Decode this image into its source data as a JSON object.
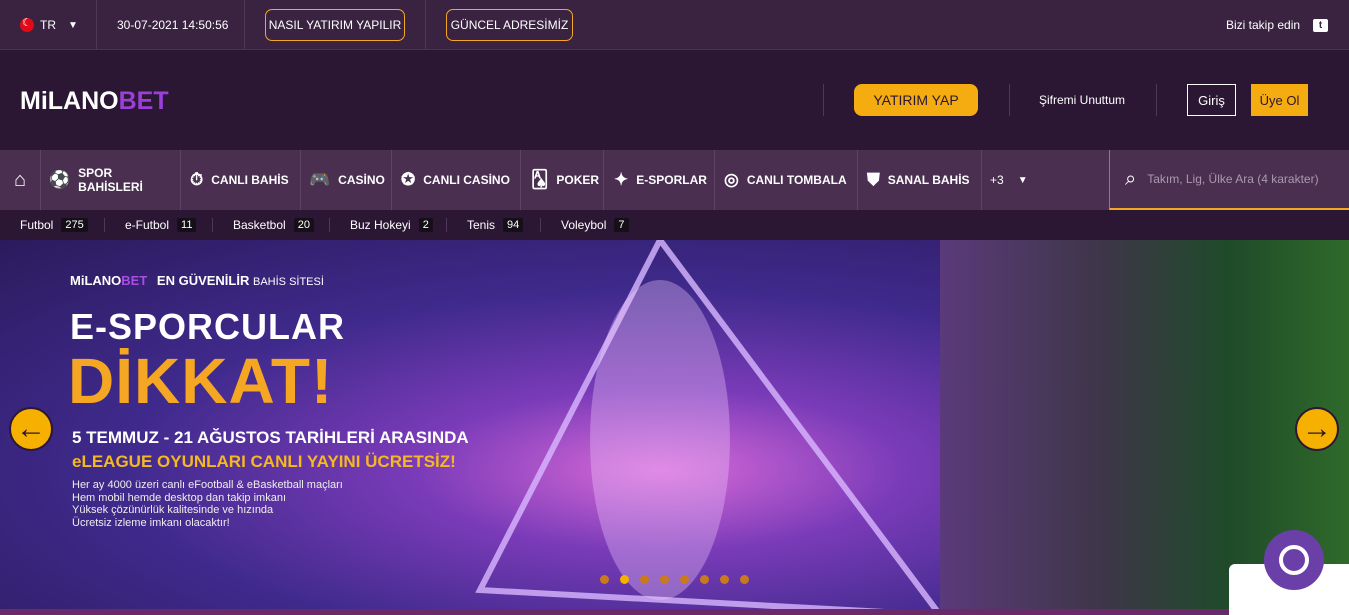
{
  "topbar": {
    "lang": "TR",
    "datetime": "30-07-2021 14:50:56",
    "btn_how": "NASIL YATIRIM YAPILIR",
    "btn_address": "GÜNCEL ADRESİMİZ",
    "follow": "Bizi takip edin"
  },
  "header": {
    "logo_a": "MiLANO",
    "logo_b": "BET",
    "deposit": "YATIRIM YAP",
    "forgot": "Şifremi Unuttum",
    "login": "Giriş",
    "register": "Üye Ol"
  },
  "nav": {
    "items": [
      {
        "label": "SPOR BAHİSLERİ",
        "icon": "soccer-ball-icon"
      },
      {
        "label": "CANLI BAHİS",
        "icon": "stopwatch-icon"
      },
      {
        "label": "CASİNO",
        "icon": "gamepad-icon"
      },
      {
        "label": "CANLI CASİNO",
        "icon": "poker-chip-icon"
      },
      {
        "label": "POKER",
        "icon": "cards-icon"
      },
      {
        "label": "E-SPORLAR",
        "icon": "esports-icon"
      },
      {
        "label": "CANLI TOMBALA",
        "icon": "tombala-icon"
      },
      {
        "label": "SANAL BAHİS",
        "icon": "shield-icon"
      }
    ],
    "more": "+3",
    "search_placeholder": "Takım, Lig, Ülke Ara (4 karakter)"
  },
  "sports": [
    {
      "name": "Futbol",
      "count": "275"
    },
    {
      "name": "e-Futbol",
      "count": "11"
    },
    {
      "name": "Basketbol",
      "count": "20"
    },
    {
      "name": "Buz Hokeyi",
      "count": "2"
    },
    {
      "name": "Tenis",
      "count": "94"
    },
    {
      "name": "Voleybol",
      "count": "7"
    }
  ],
  "banner": {
    "brand_a": "MiLANO",
    "brand_b": "BET",
    "brand_tag": "EN GÜVENİLİR",
    "brand_tag2": "BAHİS SİTESİ",
    "title1": "E-SPORCULAR",
    "title2": "DİKKAT!",
    "sub1": "5 TEMMUZ - 21 AĞUSTOS TARİHLERİ ARASINDA",
    "sub2": "eLEAGUE OYUNLARI CANLI YAYINI ÜCRETSİZ!",
    "desc": [
      "Her ay 4000 üzeri canlı eFootball & eBasketball maçları",
      "Hem mobil hemde desktop dan takip imkanı",
      "Yüksek çözünürlük kalitesinde ve hızında",
      "Ücretsiz izleme imkanı olacaktır!"
    ],
    "slide_count": 8,
    "active_slide": 2
  },
  "colors": {
    "accent": "#f5ac10",
    "brand_purple": "#9b3fd8",
    "bg": "#2b1733"
  }
}
